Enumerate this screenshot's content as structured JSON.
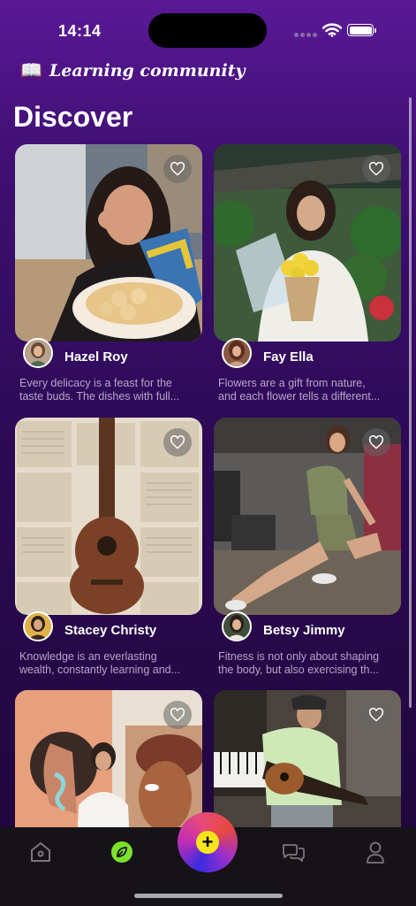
{
  "status": {
    "time": "14:14"
  },
  "header": {
    "icon": "book-icon",
    "community": "Learning community",
    "title": "Discover"
  },
  "posts": [
    {
      "name": "Hazel Roy",
      "desc1": "Every delicacy is a feast for the",
      "desc2": "taste buds. The dishes with full..."
    },
    {
      "name": "Fay Ella",
      "desc1": "Flowers are a gift from nature,",
      "desc2": "and each flower tells a different..."
    },
    {
      "name": "Stacey Christy",
      "desc1": "Knowledge is an everlasting",
      "desc2": "wealth, constantly learning and..."
    },
    {
      "name": "Betsy Jimmy",
      "desc1": "Fitness is not only about shaping",
      "desc2": "the body, but also exercising th..."
    },
    {
      "name": "",
      "desc1": "",
      "desc2": ""
    },
    {
      "name": "",
      "desc1": "",
      "desc2": ""
    }
  ],
  "tabbar": {
    "tabs": [
      "home-icon",
      "leaf-icon",
      "add-icon",
      "chat-icon",
      "profile-icon"
    ],
    "active": "leaf-icon",
    "accent": "#7be22a",
    "fab_color": "#f7e51a"
  }
}
